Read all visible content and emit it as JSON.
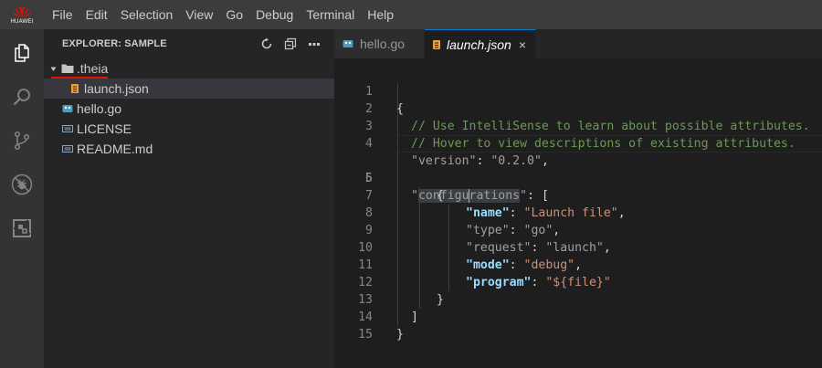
{
  "brand": {
    "logo_text": "HUAWEI",
    "color": "#e51400"
  },
  "menu": [
    "File",
    "Edit",
    "Selection",
    "View",
    "Go",
    "Debug",
    "Terminal",
    "Help"
  ],
  "activitybar": {
    "items": [
      {
        "icon": "files-icon",
        "active": true
      },
      {
        "icon": "search-icon",
        "active": false
      },
      {
        "icon": "source-control-icon",
        "active": false
      },
      {
        "icon": "debug-icon",
        "active": false
      },
      {
        "icon": "extensions-icon",
        "active": false
      }
    ]
  },
  "explorer": {
    "title": "EXPLORER: SAMPLE",
    "actions": [
      "refresh-icon",
      "collapse-all-icon",
      "more-icon"
    ],
    "tree": [
      {
        "label": ".theia",
        "type": "folder",
        "expanded": true,
        "icon": "folder-icon"
      },
      {
        "label": "launch.json",
        "type": "file",
        "icon": "json-file-icon",
        "selected": true
      },
      {
        "label": "hello.go",
        "type": "file",
        "icon": "go-file-icon"
      },
      {
        "label": "LICENSE",
        "type": "file",
        "icon": "text-file-icon"
      },
      {
        "label": "README.md",
        "type": "file",
        "icon": "markdown-file-icon"
      }
    ]
  },
  "tabs": [
    {
      "label": "hello.go",
      "icon": "go-file-icon",
      "active": false
    },
    {
      "label": "launch.json",
      "icon": "json-file-icon",
      "active": true,
      "close": "×"
    }
  ],
  "editor": {
    "active_line": 5,
    "line_numbers": [
      "1",
      "2",
      "3",
      "4",
      "5",
      "6",
      "7",
      "8",
      "9",
      "10",
      "11",
      "12",
      "13",
      "14",
      "15"
    ],
    "code": {
      "l1": "{",
      "l2": "// Use IntelliSense to learn about possible attributes.",
      "l3": "// Hover to view descriptions of existing attributes.",
      "l4_key": "\"version\"",
      "l4_colon": ": ",
      "l4_val": "\"0.2.0\"",
      "l4_end": ",",
      "l5_q1": "\"",
      "l5_a": "configu",
      "l5_b": "rations",
      "l5_q2": "\"",
      "l5_rest": ": [",
      "l6": "{",
      "l7_key": "\"name\"",
      "l7_val": "\"Launch file\"",
      "l8_key": "\"type\"",
      "l8_val": "\"go\"",
      "l9_key": "\"request\"",
      "l9_val": "\"launch\"",
      "l10_key": "\"mode\"",
      "l10_val": "\"debug\"",
      "l11_key": "\"program\"",
      "l11_val": "\"${file}\"",
      "colon": ": ",
      "comma": ",",
      "l12": "}",
      "l13": "]",
      "l14": "}"
    }
  },
  "colors": {
    "accent": "#007acc",
    "json_icon": "#e8a23b",
    "go_icon": "#519aba",
    "comment": "#6a9955",
    "string": "#ce9178",
    "key": "#9cdcfe"
  }
}
